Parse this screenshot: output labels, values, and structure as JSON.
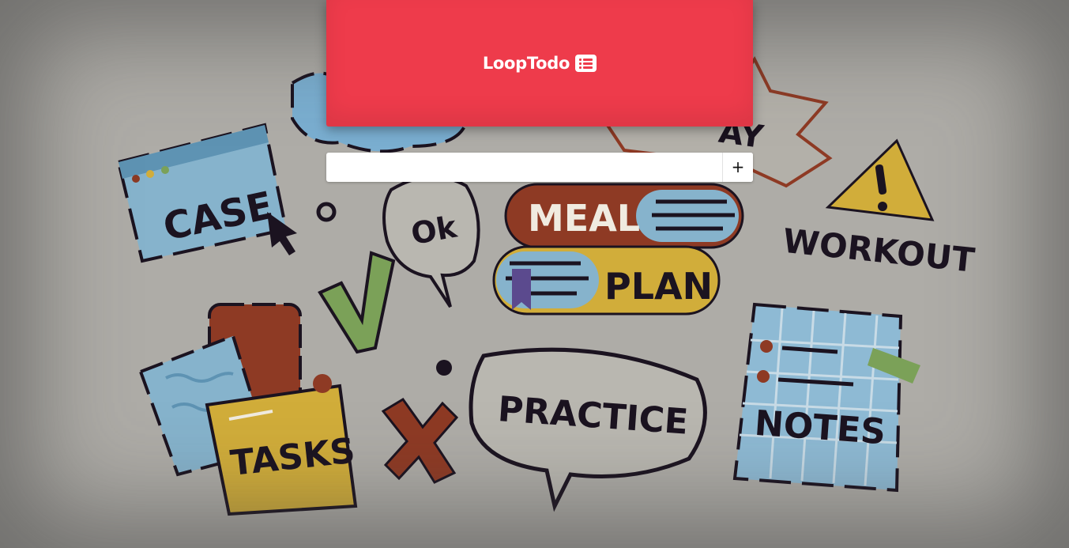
{
  "app": {
    "title": "LoopTodo",
    "icon": "list-icon",
    "accent_color": "#ee3b4b"
  },
  "todo_form": {
    "input_value": "",
    "input_placeholder": "",
    "add_button_label": "+"
  },
  "background_art": {
    "stickers": [
      "CASE",
      "Ok",
      "MEAL",
      "PLAN",
      "WORKOUT",
      "TASKS",
      "PRACTICE",
      "NOTES",
      "AY"
    ]
  }
}
